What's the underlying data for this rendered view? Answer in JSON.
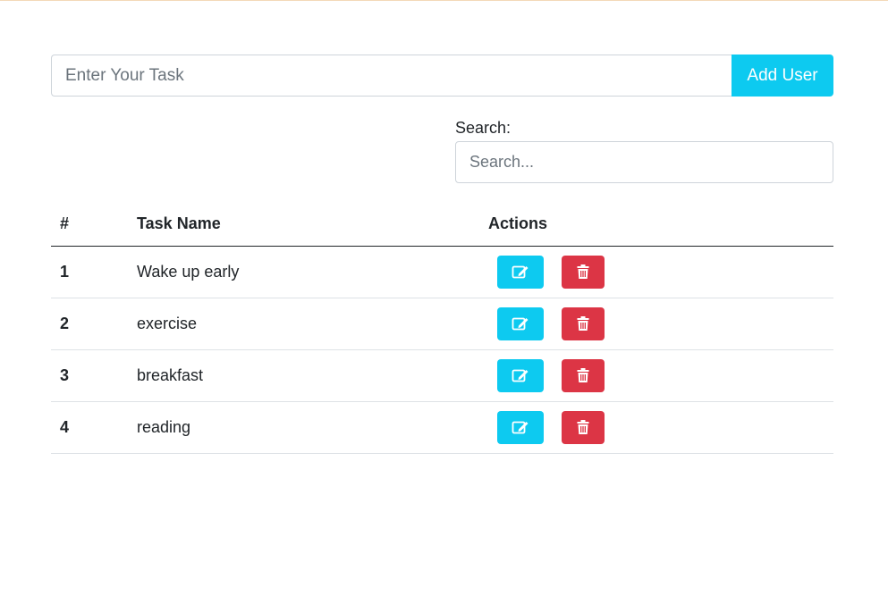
{
  "colors": {
    "info": "#0dcaf0",
    "danger": "#dc3545",
    "text": "#212529",
    "border": "#ced4da"
  },
  "add_task": {
    "placeholder": "Enter Your Task",
    "value": "",
    "button_label": "Add User"
  },
  "search": {
    "label": "Search:",
    "placeholder": "Search...",
    "value": ""
  },
  "table": {
    "headers": [
      "#",
      "Task Name",
      "Actions"
    ],
    "rows": [
      {
        "num": "1",
        "name": "Wake up early"
      },
      {
        "num": "2",
        "name": "exercise"
      },
      {
        "num": "3",
        "name": "breakfast"
      },
      {
        "num": "4",
        "name": "reading"
      }
    ],
    "actions": {
      "edit_icon": "edit-icon",
      "delete_icon": "trash-icon"
    }
  }
}
